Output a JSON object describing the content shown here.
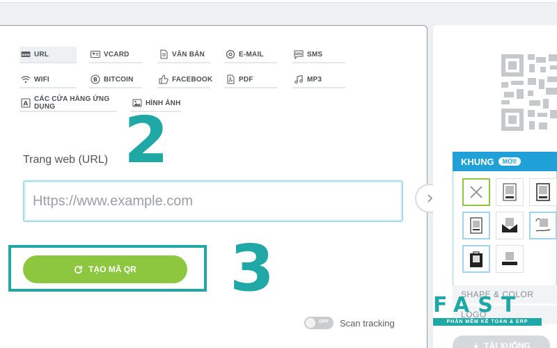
{
  "qr_types": [
    {
      "label": "URL",
      "icon": "url-icon",
      "active": true
    },
    {
      "label": "VCARD",
      "icon": "vcard-icon"
    },
    {
      "label": "VĂN BẢN",
      "icon": "text-document-icon"
    },
    {
      "label": "E-MAIL",
      "icon": "at-sign-icon"
    },
    {
      "label": "SMS",
      "icon": "sms-icon"
    },
    {
      "label": "WIFI",
      "icon": "wifi-icon"
    },
    {
      "label": "BITCOIN",
      "icon": "bitcoin-icon"
    },
    {
      "label": "FACEBOOK",
      "icon": "thumbs-up-icon"
    },
    {
      "label": "PDF",
      "icon": "pdf-icon"
    },
    {
      "label": "MP3",
      "icon": "music-note-icon"
    },
    {
      "label": "CÁC CỬA HÀNG ỨNG DỤNG",
      "icon": "app-store-icon"
    },
    {
      "label": "HÌNH ẢNH",
      "icon": "image-icon"
    }
  ],
  "annotations": {
    "step_2": "2",
    "step_3": "3"
  },
  "form": {
    "label": "Trang web (URL)",
    "placeholder": "Https://www.example.com",
    "value": ""
  },
  "generate_button": {
    "label": "TẠO MÃ QR",
    "icon": "refresh-icon"
  },
  "tracking": {
    "toggle_state": "OFF",
    "label": "Scan tracking"
  },
  "frame_panel": {
    "title": "KHUNG",
    "badge": "MỚI!",
    "options": [
      {
        "name": "no-frame",
        "selected": true
      },
      {
        "name": "frame-scan-me-1"
      },
      {
        "name": "frame-scan-me-2"
      },
      {
        "name": "frame-clipboard"
      },
      {
        "name": "frame-envelope"
      },
      {
        "name": "frame-script"
      },
      {
        "name": "frame-bag"
      },
      {
        "name": "frame-banner"
      }
    ]
  },
  "sections": {
    "shape_color": "SHAPE & COLOR",
    "logo": "LOGO"
  },
  "download_button": {
    "label": "TẢI XUỐNG"
  },
  "watermark": {
    "brand": "FAST",
    "tagline": "PHẦN MỀM KẾ TOÁN & ERP"
  },
  "colors": {
    "accent_teal": "#1fa8a6",
    "button_green": "#8dc63f",
    "frame_blue": "#1fa1d8"
  }
}
